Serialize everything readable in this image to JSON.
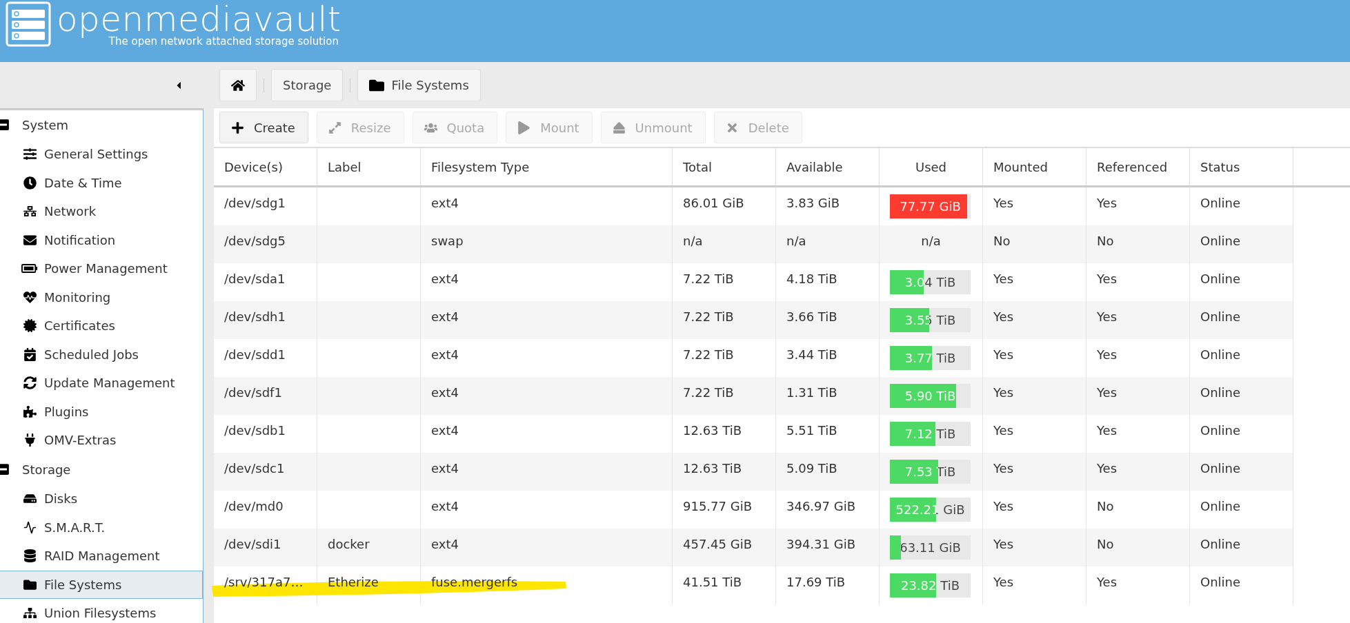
{
  "header": {
    "title": "openmediavault",
    "subtitle": "The open network attached storage solution"
  },
  "breadcrumb": [
    {
      "kind": "home"
    },
    {
      "kind": "text",
      "label": "Storage"
    },
    {
      "kind": "folder",
      "label": "File Systems"
    }
  ],
  "sidebar": {
    "groups": [
      {
        "label": "System",
        "expanded": true,
        "items": [
          {
            "label": "General Settings",
            "selected": false
          },
          {
            "label": "Date & Time",
            "selected": false
          },
          {
            "label": "Network",
            "selected": false
          },
          {
            "label": "Notification",
            "selected": false
          },
          {
            "label": "Power Management",
            "selected": false
          },
          {
            "label": "Monitoring",
            "selected": false
          },
          {
            "label": "Certificates",
            "selected": false
          },
          {
            "label": "Scheduled Jobs",
            "selected": false
          },
          {
            "label": "Update Management",
            "selected": false
          },
          {
            "label": "Plugins",
            "selected": false
          },
          {
            "label": "OMV-Extras",
            "selected": false
          }
        ]
      },
      {
        "label": "Storage",
        "expanded": true,
        "items": [
          {
            "label": "Disks",
            "selected": false
          },
          {
            "label": "S.M.A.R.T.",
            "selected": false
          },
          {
            "label": "RAID Management",
            "selected": false
          },
          {
            "label": "File Systems",
            "selected": true
          },
          {
            "label": "Union Filesystems",
            "selected": false
          }
        ]
      }
    ]
  },
  "toolbar": [
    {
      "label": "Create",
      "disabled": false
    },
    {
      "label": "Resize",
      "disabled": true
    },
    {
      "label": "Quota",
      "disabled": true
    },
    {
      "label": "Mount",
      "disabled": true
    },
    {
      "label": "Unmount",
      "disabled": true
    },
    {
      "label": "Delete",
      "disabled": true
    }
  ],
  "table": {
    "columns": [
      "Device(s)",
      "Label",
      "Filesystem Type",
      "Total",
      "Available",
      "Used",
      "Mounted",
      "Referenced",
      "Status"
    ],
    "rows": [
      {
        "device": "/dev/sdg1",
        "label": "",
        "type": "ext4",
        "total": "86.01 GiB",
        "available": "3.83 GiB",
        "used": {
          "kind": "bar",
          "text": "77.77 GiB",
          "level": 0.96,
          "color": "#ff3b30"
        },
        "mounted": "Yes",
        "referenced": "Yes",
        "status": "Online",
        "highlighted": false
      },
      {
        "device": "/dev/sdg5",
        "label": "",
        "type": "swap",
        "total": "n/a",
        "available": "n/a",
        "used": {
          "kind": "text",
          "text": "n/a"
        },
        "mounted": "No",
        "referenced": "No",
        "status": "Online",
        "highlighted": false
      },
      {
        "device": "/dev/sda1",
        "label": "",
        "type": "ext4",
        "total": "7.22 TiB",
        "available": "4.18 TiB",
        "used": {
          "kind": "bar",
          "text": "3.04 TiB",
          "level": 0.42,
          "color": "#4cd964"
        },
        "mounted": "Yes",
        "referenced": "Yes",
        "status": "Online",
        "highlighted": false
      },
      {
        "device": "/dev/sdh1",
        "label": "",
        "type": "ext4",
        "total": "7.22 TiB",
        "available": "3.66 TiB",
        "used": {
          "kind": "bar",
          "text": "3.55 TiB",
          "level": 0.49,
          "color": "#4cd964"
        },
        "mounted": "Yes",
        "referenced": "Yes",
        "status": "Online",
        "highlighted": false
      },
      {
        "device": "/dev/sdd1",
        "label": "",
        "type": "ext4",
        "total": "7.22 TiB",
        "available": "3.44 TiB",
        "used": {
          "kind": "bar",
          "text": "3.77 TiB",
          "level": 0.52,
          "color": "#4cd964"
        },
        "mounted": "Yes",
        "referenced": "Yes",
        "status": "Online",
        "highlighted": false
      },
      {
        "device": "/dev/sdf1",
        "label": "",
        "type": "ext4",
        "total": "7.22 TiB",
        "available": "1.31 TiB",
        "used": {
          "kind": "bar",
          "text": "5.90 TiB",
          "level": 0.82,
          "color": "#4cd964"
        },
        "mounted": "Yes",
        "referenced": "Yes",
        "status": "Online",
        "highlighted": false
      },
      {
        "device": "/dev/sdb1",
        "label": "",
        "type": "ext4",
        "total": "12.63 TiB",
        "available": "5.51 TiB",
        "used": {
          "kind": "bar",
          "text": "7.12 TiB",
          "level": 0.56,
          "color": "#4cd964"
        },
        "mounted": "Yes",
        "referenced": "Yes",
        "status": "Online",
        "highlighted": false
      },
      {
        "device": "/dev/sdc1",
        "label": "",
        "type": "ext4",
        "total": "12.63 TiB",
        "available": "5.09 TiB",
        "used": {
          "kind": "bar",
          "text": "7.53 TiB",
          "level": 0.6,
          "color": "#4cd964"
        },
        "mounted": "Yes",
        "referenced": "Yes",
        "status": "Online",
        "highlighted": false
      },
      {
        "device": "/dev/md0",
        "label": "",
        "type": "ext4",
        "total": "915.77 GiB",
        "available": "346.97 GiB",
        "used": {
          "kind": "bar",
          "text": "522.21 GiB",
          "level": 0.57,
          "color": "#4cd964"
        },
        "mounted": "Yes",
        "referenced": "No",
        "status": "Online",
        "highlighted": false
      },
      {
        "device": "/dev/sdi1",
        "label": "docker",
        "type": "ext4",
        "total": "457.45 GiB",
        "available": "394.31 GiB",
        "used": {
          "kind": "bar",
          "text": "63.11 GiB",
          "level": 0.14,
          "color": "#4cd964"
        },
        "mounted": "Yes",
        "referenced": "No",
        "status": "Online",
        "highlighted": false
      },
      {
        "device": "/srv/317a7…",
        "label": "Etherize",
        "type": "fuse.mergerfs",
        "total": "41.51 TiB",
        "available": "17.69 TiB",
        "used": {
          "kind": "bar",
          "text": "23.82 TiB",
          "level": 0.57,
          "color": "#4cd964"
        },
        "mounted": "Yes",
        "referenced": "Yes",
        "status": "Online",
        "highlighted": true
      }
    ]
  }
}
